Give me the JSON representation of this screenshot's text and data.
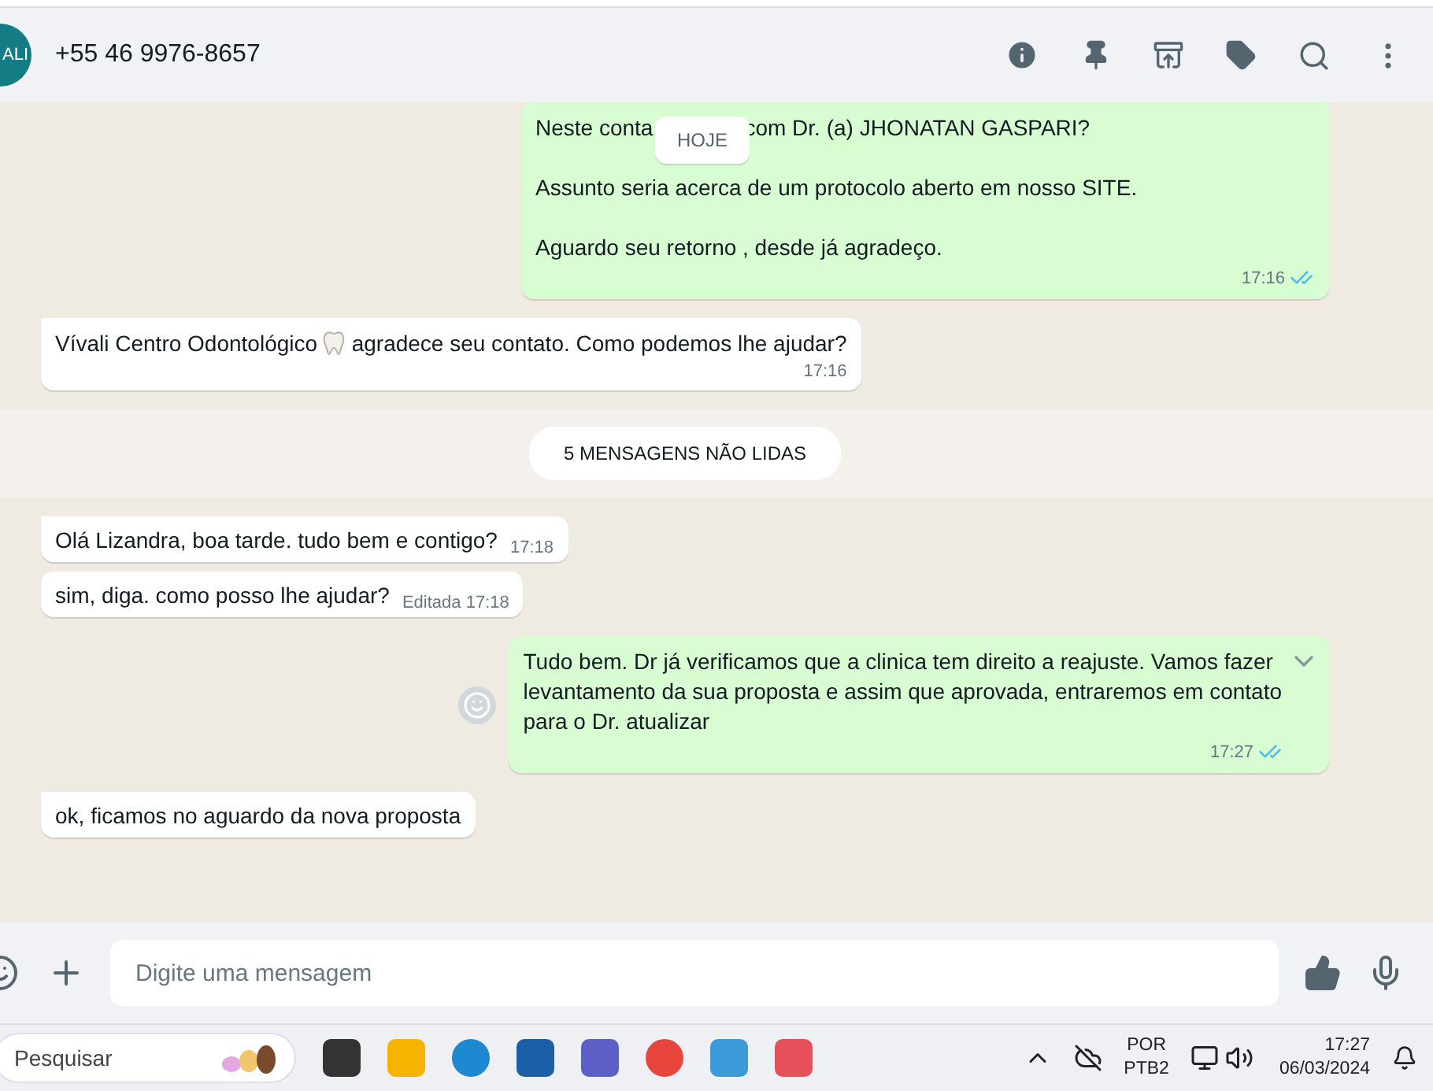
{
  "header": {
    "avatar_text": "ALI",
    "contact": "+55 46 9976-8657"
  },
  "date_chip": "HOJE",
  "messages": [
    {
      "kind": "out",
      "chip_line": {
        "before": "Neste conta",
        "after": "com Dr. (a)  JHONATAN GASPARI?"
      },
      "paragraphs": [
        "Assunto seria acerca de um protocolo aberto em nosso SITE.",
        "Aguardo seu retorno , desde já agradeço."
      ],
      "time": "17:16",
      "read": true
    },
    {
      "kind": "in",
      "before_icon": "Vívali Centro Odontológico",
      "after_icon": "agradece seu contato. Como podemos lhe ajudar?",
      "time": "17:16",
      "tail": true
    },
    {
      "kind": "unread",
      "text": "5 MENSAGENS NÃO LIDAS"
    },
    {
      "kind": "in",
      "text": "Olá Lizandra, boa tarde. tudo bem e contigo?",
      "time": "17:18",
      "tail": true
    },
    {
      "kind": "in",
      "text": "sim, diga. como posso lhe ajudar?",
      "edited": "Editada",
      "time": "17:18",
      "tail": false
    },
    {
      "kind": "out",
      "lines": [
        "Tudo bem. Dr já verificamos que a clinica tem direito a reajuste. Vamos fazer",
        "levantamento da sua proposta e assim que aprovada, entraremos em contato",
        "para o Dr. atualizar"
      ],
      "time": "17:27",
      "read": true,
      "menu": true
    },
    {
      "kind": "in",
      "text": "ok, ficamos no aguardo da nova proposta",
      "tail": true
    }
  ],
  "composer": {
    "placeholder": "Digite uma mensagem"
  },
  "taskbar": {
    "search": "Pesquisar",
    "lang": "POR",
    "layout": "PTB2",
    "time": "17:27",
    "date": "06/03/2024"
  }
}
